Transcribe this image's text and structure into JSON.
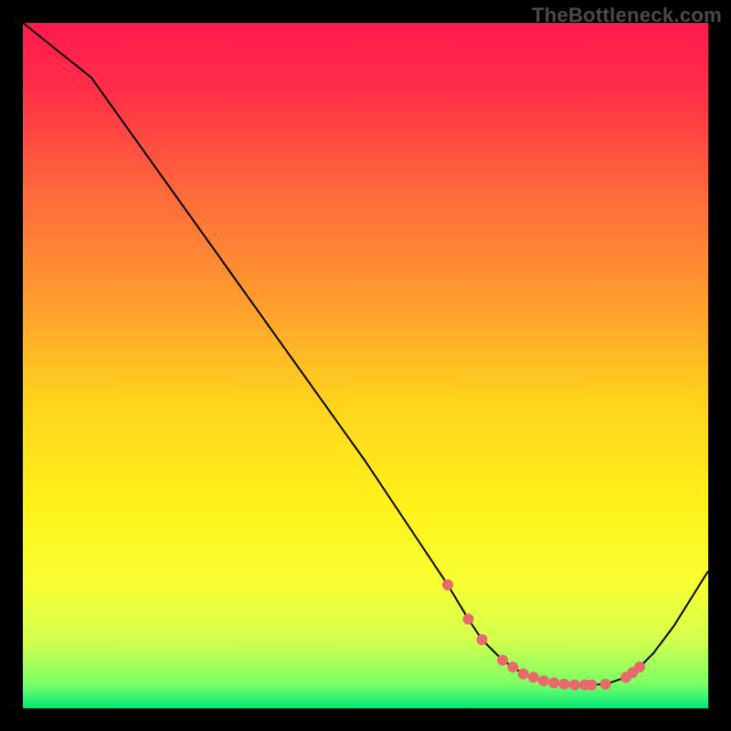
{
  "watermark": "TheBottleneck.com",
  "colors": {
    "frame": "#000000",
    "watermark": "#4a4a4a",
    "line": "#000000",
    "marker": "#e86a6a",
    "gradient_stops": [
      {
        "offset": 0.0,
        "color": "#ff1a4e"
      },
      {
        "offset": 0.1,
        "color": "#ff2f48"
      },
      {
        "offset": 0.25,
        "color": "#ff6a3c"
      },
      {
        "offset": 0.4,
        "color": "#ff9a2e"
      },
      {
        "offset": 0.55,
        "color": "#ffd21f"
      },
      {
        "offset": 0.7,
        "color": "#fff11a"
      },
      {
        "offset": 0.82,
        "color": "#f7ff33"
      },
      {
        "offset": 0.9,
        "color": "#d4ff4d"
      },
      {
        "offset": 0.965,
        "color": "#7bff66"
      },
      {
        "offset": 1.0,
        "color": "#00e876"
      }
    ]
  },
  "chart_data": {
    "type": "line",
    "title": "",
    "xlabel": "",
    "ylabel": "",
    "xlim": [
      0,
      100
    ],
    "ylim": [
      0,
      100
    ],
    "series": [
      {
        "name": "curve",
        "x": [
          0,
          5,
          10,
          20,
          30,
          40,
          50,
          58,
          62,
          65,
          67,
          70,
          73,
          76,
          79,
          82,
          85,
          88,
          90,
          92,
          95,
          100
        ],
        "y": [
          100,
          96,
          92,
          78,
          64,
          50,
          36,
          24,
          18,
          13,
          10,
          7,
          5,
          4,
          3.5,
          3.4,
          3.5,
          4.5,
          6,
          8,
          12,
          20
        ]
      }
    ],
    "markers": {
      "name": "highlight-points",
      "x": [
        62,
        65,
        67,
        70,
        71.5,
        73,
        74.5,
        76,
        77.5,
        79,
        80.5,
        82,
        83,
        85,
        88,
        89,
        90
      ],
      "y": [
        18,
        13,
        10,
        7,
        6,
        5,
        4.5,
        4,
        3.7,
        3.5,
        3.4,
        3.4,
        3.4,
        3.5,
        4.5,
        5.2,
        6
      ]
    }
  }
}
